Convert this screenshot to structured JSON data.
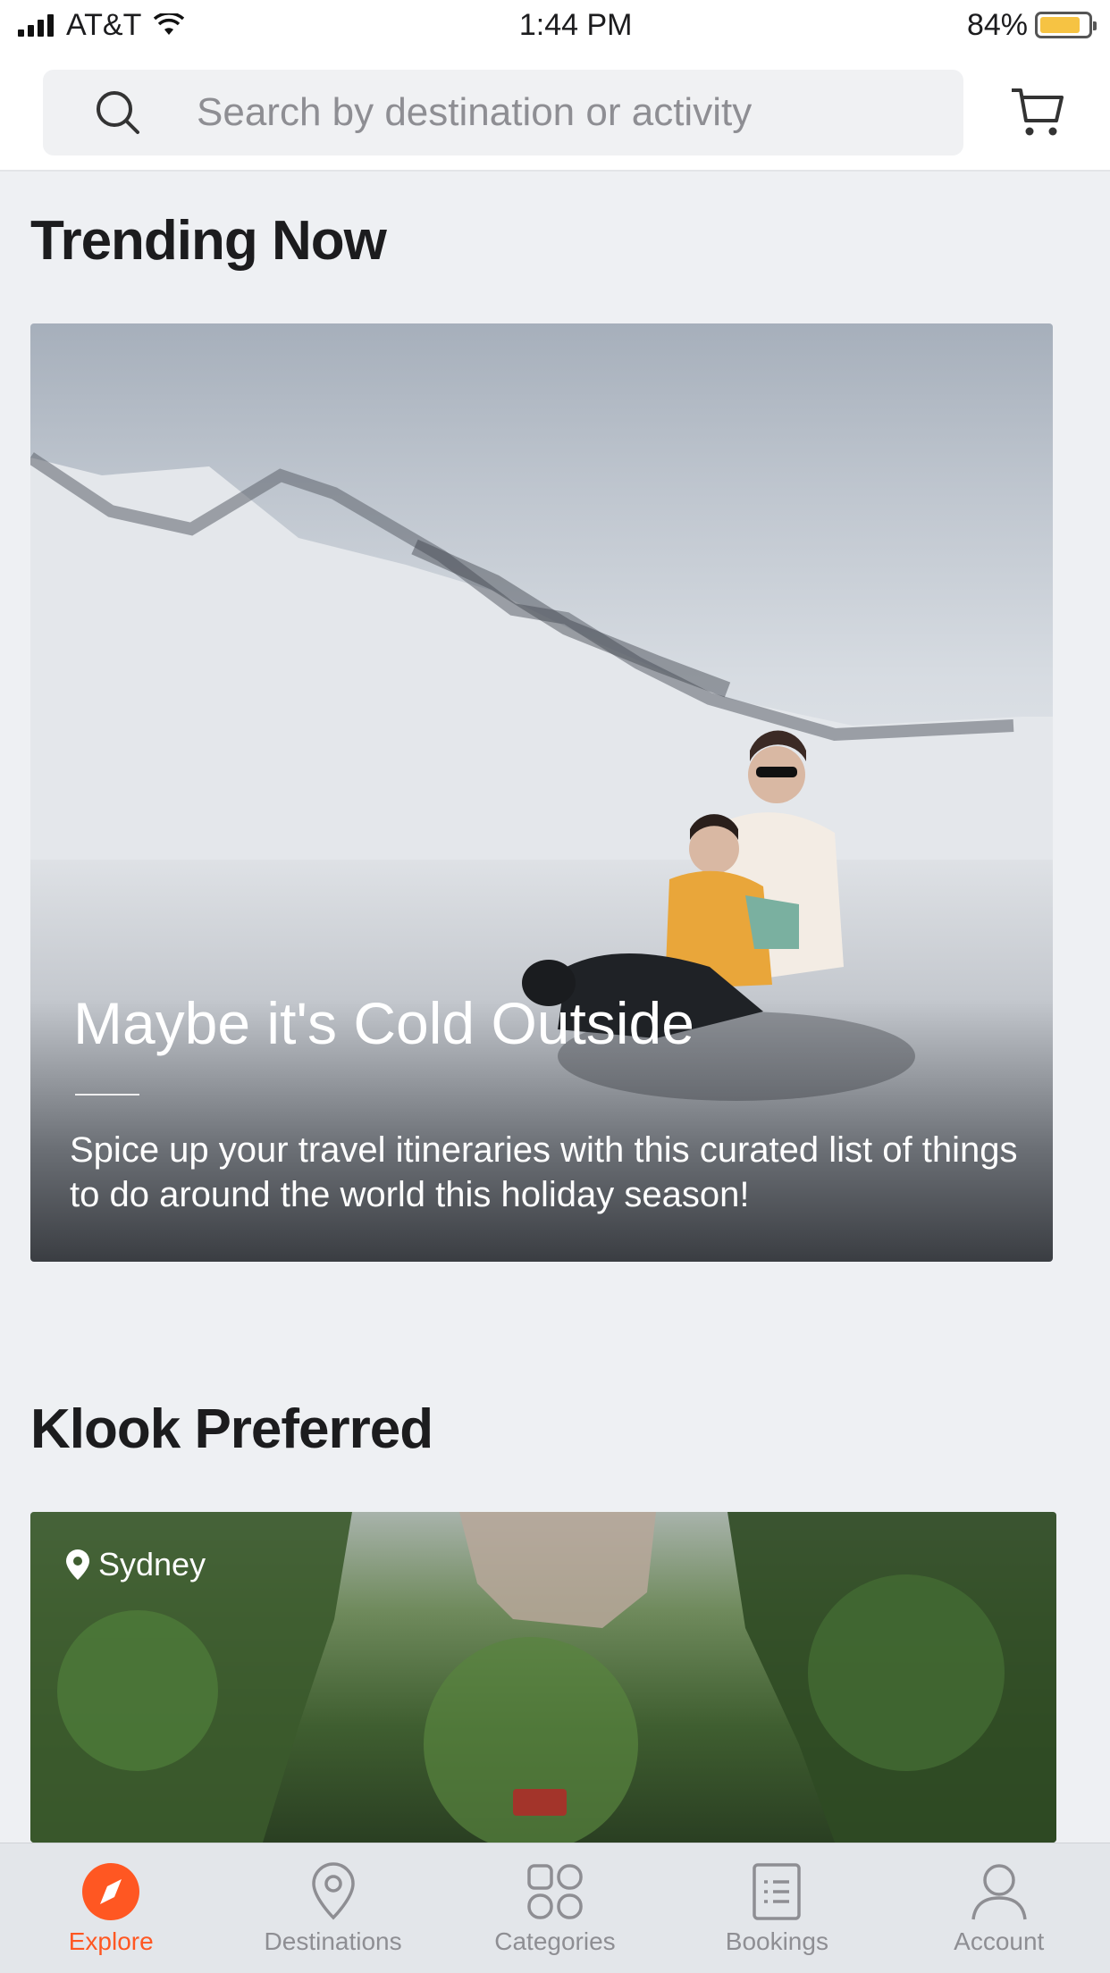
{
  "status_bar": {
    "carrier": "AT&T",
    "time": "1:44 PM",
    "battery": "84%",
    "battery_level": 0.84
  },
  "search": {
    "placeholder": "Search by destination or activity"
  },
  "trending": {
    "section_title": "Trending Now",
    "card_title": "Maybe it's Cold Outside",
    "card_description": "Spice up your travel itineraries with this curated list of things to do around the world this holiday season!"
  },
  "preferred": {
    "section_title": "Klook Preferred",
    "location": "Sydney"
  },
  "nav": {
    "items": [
      {
        "label": "Explore",
        "icon": "compass-icon",
        "active": true
      },
      {
        "label": "Destinations",
        "icon": "location-pin-icon",
        "active": false
      },
      {
        "label": "Categories",
        "icon": "grid-icon",
        "active": false
      },
      {
        "label": "Bookings",
        "icon": "list-icon",
        "active": false
      },
      {
        "label": "Account",
        "icon": "user-icon",
        "active": false
      }
    ]
  },
  "colors": {
    "accent": "#ff5722",
    "inactive": "#8e8e93",
    "battery_fill": "#f6c343"
  }
}
